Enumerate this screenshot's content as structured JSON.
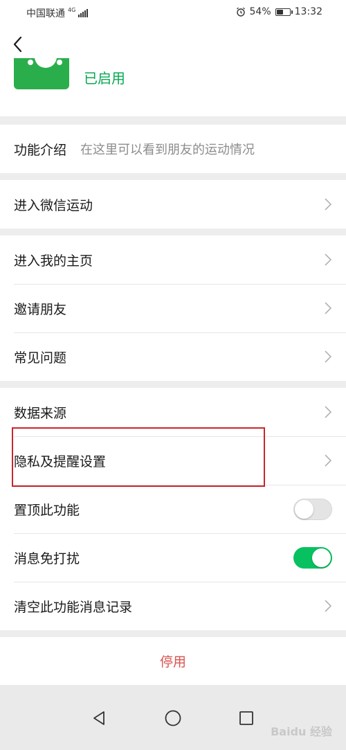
{
  "status_bar": {
    "carrier": "中国联通",
    "network": "4G",
    "battery": "54%",
    "battery_level": 0.54,
    "time": "13:32"
  },
  "header": {
    "back_icon": "back-arrow-icon",
    "status": "已启用"
  },
  "intro": {
    "label": "功能介绍",
    "desc": "在这里可以看到朋友的运动情况"
  },
  "section_sport": {
    "items": [
      {
        "label": "进入微信运动"
      }
    ]
  },
  "section_social": {
    "items": [
      {
        "label": "进入我的主页"
      },
      {
        "label": "邀请朋友"
      },
      {
        "label": "常见问题"
      }
    ]
  },
  "section_settings": {
    "items": [
      {
        "label": "数据来源"
      },
      {
        "label": "隐私及提醒设置"
      },
      {
        "label": "置顶此功能",
        "toggle": false
      },
      {
        "label": "消息免打扰",
        "toggle": true
      },
      {
        "label": "清空此功能消息记录"
      }
    ]
  },
  "danger": {
    "label": "停用"
  },
  "nav": {
    "back_icon": "nav-back-icon",
    "home_icon": "nav-home-icon",
    "recent_icon": "nav-recent-icon"
  },
  "watermark": "Baidu 经验",
  "colors": {
    "accent_green": "#07c160",
    "status_green": "#07a852",
    "danger_red": "#d9534f",
    "highlight_red": "#c9252c"
  }
}
